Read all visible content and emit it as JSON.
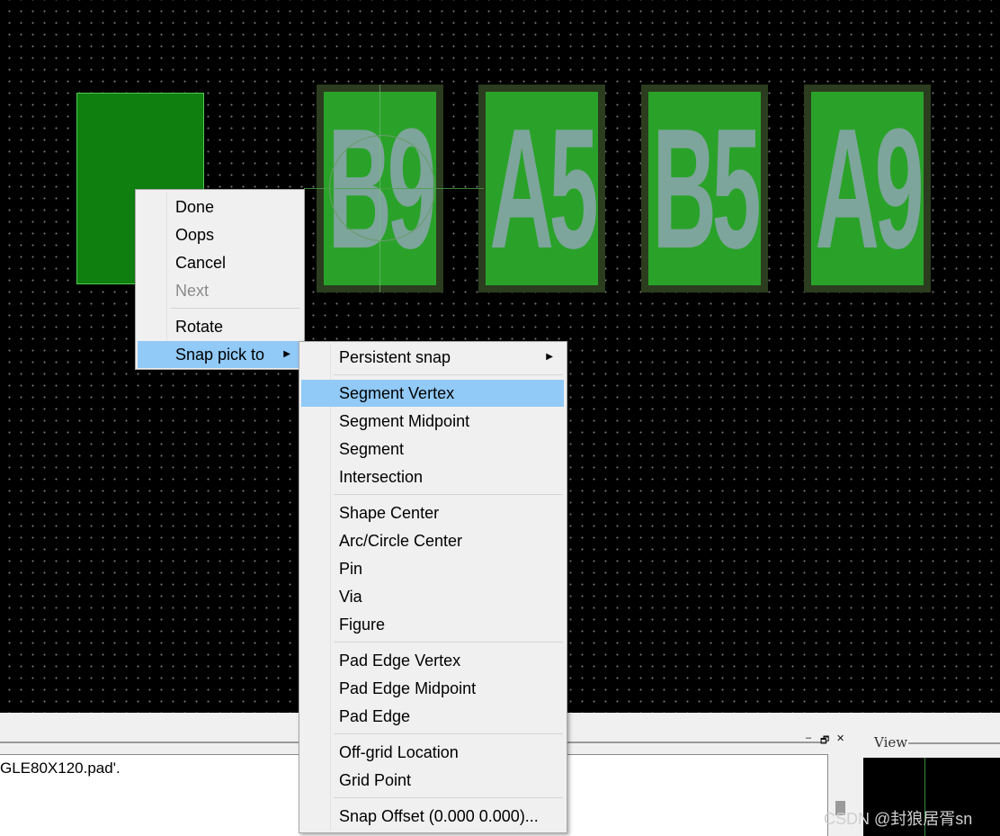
{
  "canvas": {
    "pads": [
      {
        "label": "B9"
      },
      {
        "label": "A5"
      },
      {
        "label": "B5"
      },
      {
        "label": "A9"
      }
    ]
  },
  "context_menu": {
    "items": [
      {
        "label": "Done"
      },
      {
        "label": "Oops"
      },
      {
        "label": "Cancel"
      },
      {
        "label": "Next",
        "disabled": true
      },
      {
        "label": "Rotate"
      },
      {
        "label": "Snap pick to",
        "submenu": true,
        "highlighted": true
      }
    ]
  },
  "snap_menu": {
    "items": [
      {
        "label": "Persistent snap",
        "submenu": true
      },
      {
        "label": "Segment Vertex",
        "highlighted": true
      },
      {
        "label": "Segment Midpoint"
      },
      {
        "label": "Segment"
      },
      {
        "label": "Intersection"
      },
      {
        "label": "Shape Center"
      },
      {
        "label": "Arc/Circle Center"
      },
      {
        "label": "Pin"
      },
      {
        "label": "Via"
      },
      {
        "label": "Figure"
      },
      {
        "label": "Pad Edge Vertex"
      },
      {
        "label": "Pad Edge Midpoint"
      },
      {
        "label": "Pad Edge"
      },
      {
        "label": "Off-grid Location"
      },
      {
        "label": "Grid Point"
      },
      {
        "label": "Snap Offset (0.000 0.000)..."
      }
    ]
  },
  "console": {
    "text": "GLE80X120.pad'."
  },
  "view_panel": {
    "title": "View"
  },
  "window_controls": {
    "minimize": "–",
    "restore": "🗗",
    "close": "✕"
  },
  "watermark": "CSDN @封狼居胥sn",
  "colors": {
    "canvas_bg": "#000000",
    "pad_fill": "#2aa22a",
    "pad_border": "#2b3d1e",
    "pad_text": "#7da59b",
    "menu_bg": "#f0f0f0",
    "menu_highlight": "#91c9f7"
  }
}
